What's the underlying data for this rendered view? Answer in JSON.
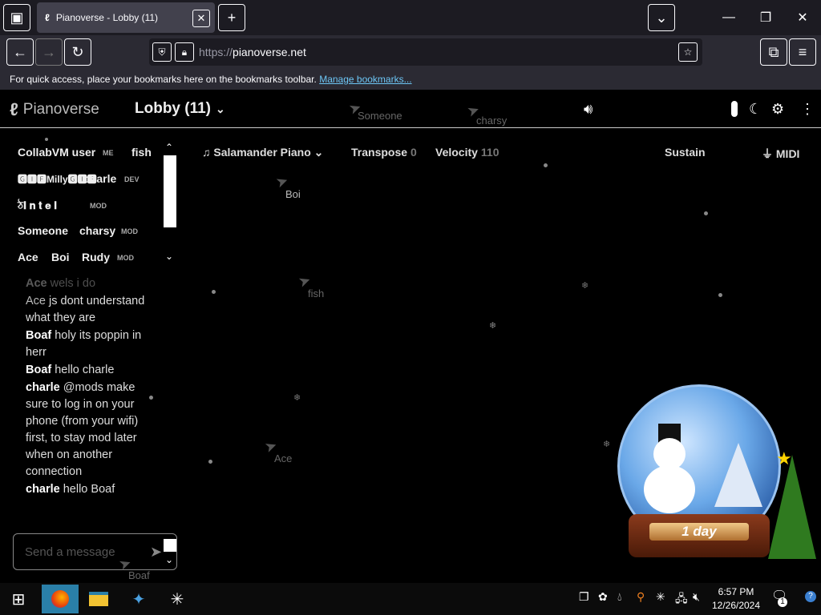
{
  "browser": {
    "tab_title": "Pianoverse - Lobby (11)",
    "url_scheme": "https://",
    "url_host": "pianoverse.net",
    "bookmarks_text": "For quick access, place your bookmarks here on the bookmarks toolbar.",
    "bookmarks_link": "Manage bookmarks..."
  },
  "header": {
    "logo_text": "Pianoverse",
    "room_title": "Lobby (11)"
  },
  "users": [
    {
      "name": "CollabVM user",
      "badge": "ME"
    },
    {
      "name": "fish",
      "badge": ""
    },
    {
      "name": "🅶🅸🅵Milly🅶🅸🅵",
      "badge": ""
    },
    {
      "name": "charle",
      "badge": "DEV"
    },
    {
      "name": "ঠ𝐈 𝐧 𝐭 𝐞 𝐥",
      "badge": "MOD"
    },
    {
      "name": "Someone",
      "badge": ""
    },
    {
      "name": "charsy",
      "badge": "MOD"
    },
    {
      "name": "Ace",
      "badge": ""
    },
    {
      "name": "Boi",
      "badge": ""
    },
    {
      "name": "Rudy",
      "badge": "MOD"
    }
  ],
  "chat": [
    {
      "who": "Ace",
      "text": "wels i do"
    },
    {
      "who": "Ace",
      "text": "js dont understand what they are"
    },
    {
      "who": "Boaf",
      "text": "holy its poppin in herr"
    },
    {
      "who": "Boaf",
      "text": "hello charle"
    },
    {
      "who": "charle",
      "text": "@mods make sure to log in on your phone (from your wifi) first, to stay mod later when on another connection"
    },
    {
      "who": "charle",
      "text": "hello Boaf"
    }
  ],
  "message_placeholder": "Send a message",
  "toolbar": {
    "instrument": "Salamander Piano",
    "transpose_label": "Transpose",
    "transpose_value": "0",
    "velocity_label": "Velocity",
    "velocity_value": "110",
    "sustain_label": "Sustain",
    "midi_label": "MIDI"
  },
  "cursors": [
    "Someone",
    "charsy",
    "Boi",
    "fish",
    "Ace",
    "Boaf"
  ],
  "globe_day_text": "1 day",
  "taskbar": {
    "time": "6:57 PM",
    "date": "12/26/2024",
    "notifications": "1"
  }
}
